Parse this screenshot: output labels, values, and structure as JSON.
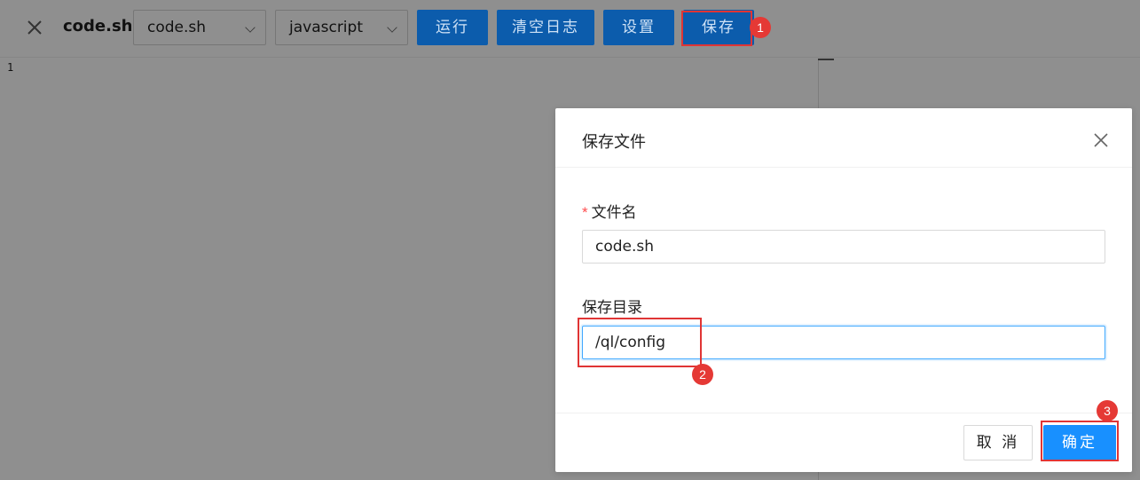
{
  "toolbar": {
    "filename": "code.sh",
    "file_select": {
      "value": "code.sh"
    },
    "language_select": {
      "value": "javascript"
    },
    "run_label": "运行",
    "clear_log_label": "清空日志",
    "settings_label": "设置",
    "save_label": "保存"
  },
  "editor": {
    "line_numbers": [
      "1"
    ]
  },
  "dialog": {
    "title": "保存文件",
    "filename_field": {
      "required_mark": "*",
      "label": "文件名",
      "value": "code.sh"
    },
    "directory_field": {
      "label": "保存目录",
      "value": "/ql/config"
    },
    "cancel_label": "取 消",
    "ok_label": "确定"
  },
  "annotations": {
    "badge_1": "1",
    "badge_2": "2",
    "badge_3": "3"
  },
  "colors": {
    "primary": "#1890ff",
    "toolbar_button": "#0c5cac",
    "highlight": "#e03535",
    "overlay": "#8f8f8f"
  }
}
